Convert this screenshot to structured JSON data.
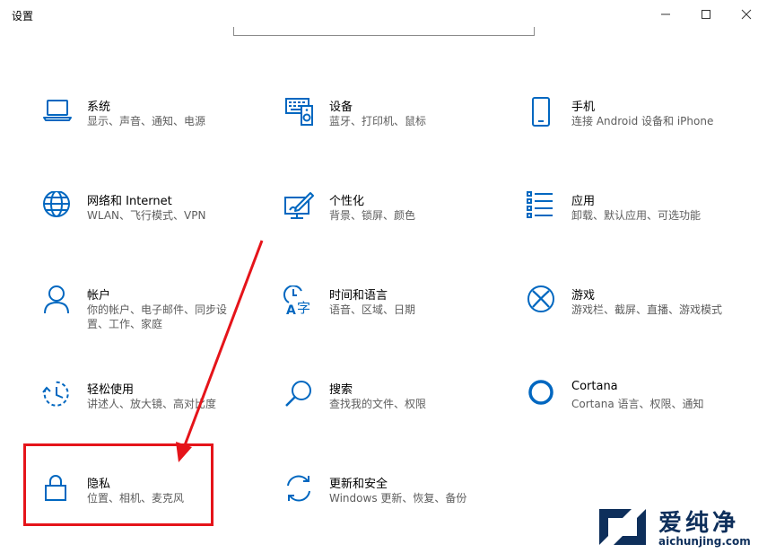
{
  "window": {
    "title": "设置"
  },
  "tiles": [
    {
      "title": "系统",
      "desc": "显示、声音、通知、电源"
    },
    {
      "title": "设备",
      "desc": "蓝牙、打印机、鼠标"
    },
    {
      "title": "手机",
      "desc": "连接 Android 设备和 iPhone"
    },
    {
      "title": "网络和 Internet",
      "desc": "WLAN、飞行模式、VPN"
    },
    {
      "title": "个性化",
      "desc": "背景、锁屏、颜色"
    },
    {
      "title": "应用",
      "desc": "卸载、默认应用、可选功能"
    },
    {
      "title": "帐户",
      "desc": "你的帐户、电子邮件、同步设置、工作、家庭"
    },
    {
      "title": "时间和语言",
      "desc": "语音、区域、日期"
    },
    {
      "title": "游戏",
      "desc": "游戏栏、截屏、直播、游戏模式"
    },
    {
      "title": "轻松使用",
      "desc": "讲述人、放大镜、高对比度"
    },
    {
      "title": "搜索",
      "desc": "查找我的文件、权限"
    },
    {
      "title": "Cortana",
      "desc": "Cortana 语言、权限、通知"
    },
    {
      "title": "隐私",
      "desc": "位置、相机、麦克风"
    },
    {
      "title": "更新和安全",
      "desc": "Windows 更新、恢复、备份"
    }
  ],
  "icons": [
    "laptop-icon",
    "keyboard-speaker-icon",
    "phone-icon",
    "globe-icon",
    "paint-icon",
    "apps-list-icon",
    "person-icon",
    "time-language-icon",
    "xbox-icon",
    "ease-of-access-icon",
    "search-icon",
    "cortana-icon",
    "lock-icon",
    "sync-icon"
  ],
  "colors": {
    "accent": "#0067c0",
    "annotation": "#e5141a",
    "watermark": "#0e2f5b"
  },
  "watermark": {
    "title": "爱纯净",
    "url": "aichunjing.com"
  }
}
